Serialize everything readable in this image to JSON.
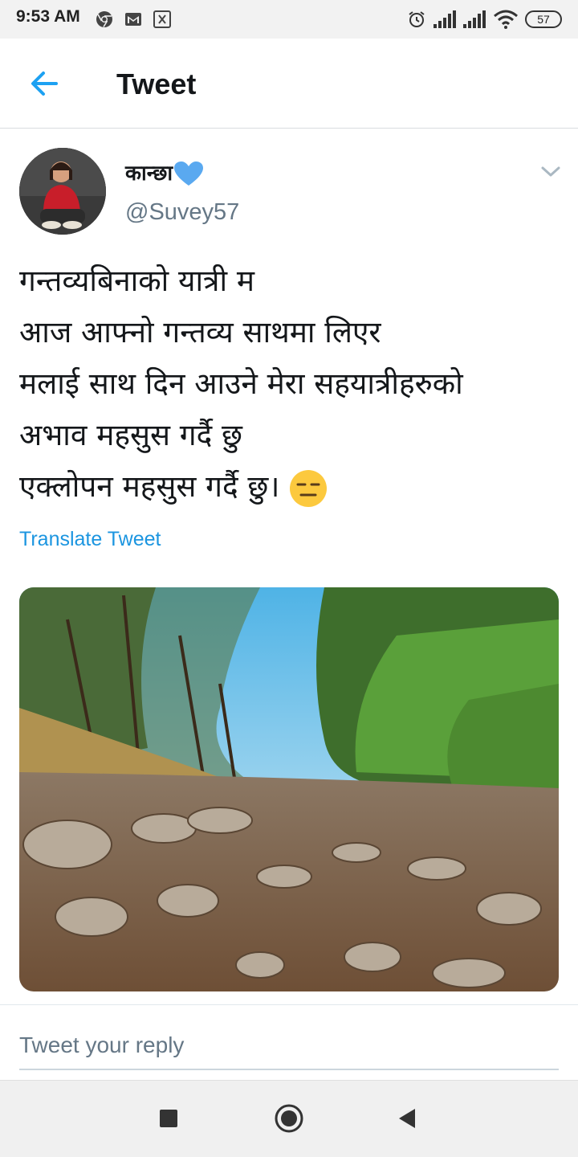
{
  "status_bar": {
    "time": "9:53 AM",
    "battery": "57",
    "left_icons": [
      "chrome-icon",
      "gmail-icon",
      "notification-icon"
    ],
    "right_icons": [
      "alarm-icon",
      "signal-icon",
      "signal-icon",
      "wifi-icon",
      "battery-icon"
    ]
  },
  "header": {
    "title": "Tweet",
    "back_icon": "back-arrow-icon"
  },
  "tweet": {
    "author_name": "कान्छा",
    "author_handle": "@Suvey57",
    "lines": [
      "गन्तव्यबिनाको यात्री म",
      "आज आफ्नो गन्तव्य साथमा लिएर",
      "मलाई साथ दिन आउने मेरा सहयात्रीहरुको",
      "अभाव महसुस गर्दै छु",
      "एक्लोपन महसुस गर्दै छु।"
    ],
    "emoji": "expressionless-face-emoji",
    "translate_label": "Translate Tweet"
  },
  "reply": {
    "placeholder": "Tweet your reply"
  },
  "colors": {
    "accent": "#1da1f2",
    "link": "#1b95e0",
    "handle": "#657786",
    "heart": "#5aa9f0"
  }
}
